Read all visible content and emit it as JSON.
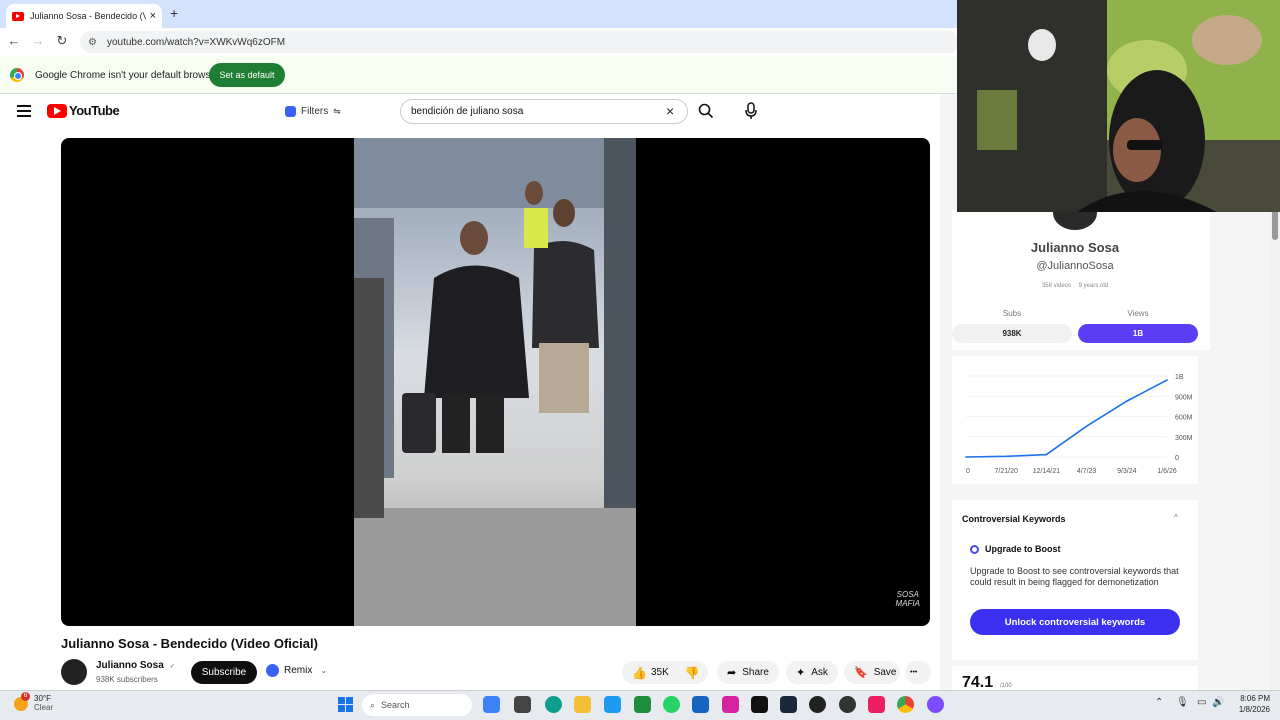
{
  "browser": {
    "tab_title": "Julianno Sosa - Bendecido (Vide",
    "tab_close": "×",
    "new_tab": "+",
    "url": "youtube.com/watch?v=XWKvWq6zOFM",
    "infobar_text": "Google Chrome isn't your default browser",
    "set_default_label": "Set as default"
  },
  "youtube": {
    "logo_text": "YouTube",
    "filters_label": "Filters",
    "search_query": "bendición de juliano sosa",
    "clear_icon": "×",
    "header_right": "◷"
  },
  "video": {
    "watermark": "SOSA\nMAFIA",
    "title": "Julianno Sosa - Bendecido (Video Oficial)",
    "channel_name": "Julianno Sosa",
    "verified": "✓",
    "subscribers": "938K subscribers",
    "subscribe_label": "Subscribe",
    "remix_label": "Remix",
    "likes": "35K",
    "share_label": "Share",
    "ask_label": "Ask",
    "save_label": "Save",
    "more": "•••"
  },
  "panel": {
    "channel_name": "Julianno Sosa",
    "handle": "@JuliannoSosa",
    "videos": "358 videos",
    "age": "9 years old",
    "subs_label": "Subs",
    "subs_value": "938K",
    "views_label": "Views",
    "views_value": "1B",
    "accent_color": "#5b3df5",
    "kw_title": "Controversial Keywords",
    "kw_chevron": "^",
    "upgrade_title": "Upgrade to Boost",
    "upgrade_desc": "Upgrade to Boost to see controversial keywords that could result in being flagged for demonetization",
    "unlock_label": "Unlock controversial keywords",
    "score": "74.1",
    "score_unit": "/100"
  },
  "chart_data": {
    "type": "line",
    "x": [
      "0",
      "7/21/20",
      "12/14/21",
      "4/7/23",
      "9/3/24",
      "1/6/26"
    ],
    "series": [
      {
        "values": [
          0,
          8000000,
          30000000,
          380000000,
          690000000,
          950000000
        ]
      }
    ],
    "y_ticks": [
      "1B",
      "900M",
      "600M",
      "300M",
      "0"
    ],
    "ylim": [
      0,
      1000000000
    ],
    "line_color": "#1a73e8"
  },
  "taskbar": {
    "weather_badge": "6",
    "temperature": "30°F",
    "condition": "Clear",
    "search_label": "Search",
    "time": "8:06 PM",
    "date": "1/8/2026"
  }
}
